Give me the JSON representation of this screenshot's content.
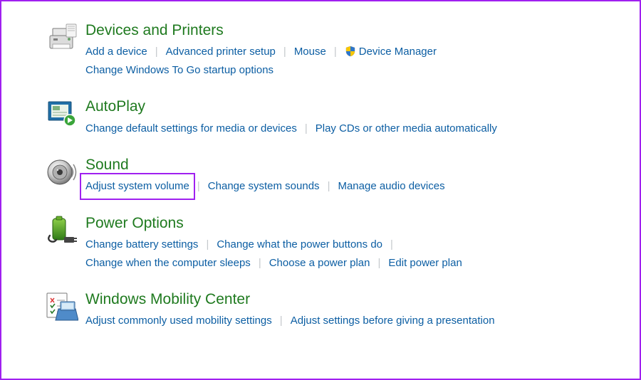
{
  "sections": {
    "devices": {
      "heading": "Devices and Printers",
      "links": {
        "add_device": "Add a device",
        "advanced_printer": "Advanced printer setup",
        "mouse": "Mouse",
        "device_manager": "Device Manager",
        "change_wtg": "Change Windows To Go startup options"
      }
    },
    "autoplay": {
      "heading": "AutoPlay",
      "links": {
        "change_default": "Change default settings for media or devices",
        "play_cds": "Play CDs or other media automatically"
      }
    },
    "sound": {
      "heading": "Sound",
      "links": {
        "adjust_volume": "Adjust system volume",
        "change_sounds": "Change system sounds",
        "manage_audio": "Manage audio devices"
      }
    },
    "power": {
      "heading": "Power Options",
      "links": {
        "battery": "Change battery settings",
        "buttons": "Change what the power buttons do",
        "sleep": "Change when the computer sleeps",
        "choose_plan": "Choose a power plan",
        "edit_plan": "Edit power plan"
      }
    },
    "mobility": {
      "heading": "Windows Mobility Center",
      "links": {
        "adjust": "Adjust commonly used mobility settings",
        "presentation": "Adjust settings before giving a presentation"
      }
    }
  }
}
